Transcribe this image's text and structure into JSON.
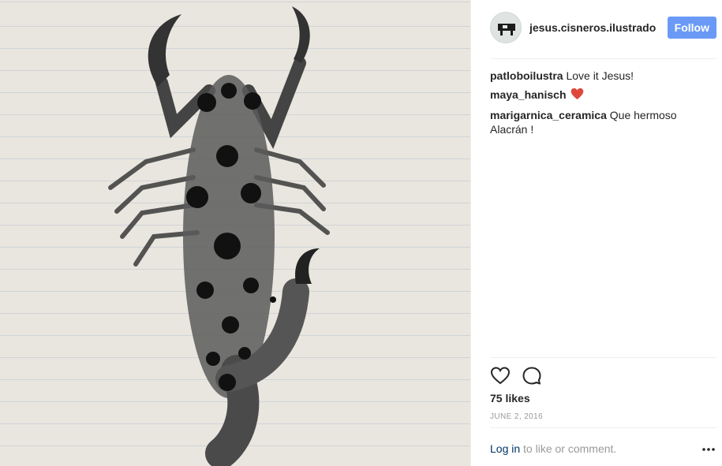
{
  "post": {
    "image_name": "scorpion-ink-drawing"
  },
  "header": {
    "username": "jesus.cisneros.ilustrador",
    "follow_label": "Follow"
  },
  "comments": [
    {
      "author": "patloboilustra",
      "text": "Love it Jesus!"
    },
    {
      "author": "maya_hanisch",
      "text": ""
    },
    {
      "author": "marigarnica_ceramica",
      "text": "Que hermoso Alacrán !"
    }
  ],
  "actions": {
    "like_icon": "heart-outline-icon",
    "comment_icon": "speech-bubble-icon"
  },
  "likes_text": "75 likes",
  "date_text": "June 2, 2016",
  "login": {
    "link_label": "Log in",
    "suffix": "to like or comment."
  },
  "colors": {
    "follow_button": "#6a9af6",
    "link": "#003569",
    "heart_emoji": "#e0473b"
  }
}
